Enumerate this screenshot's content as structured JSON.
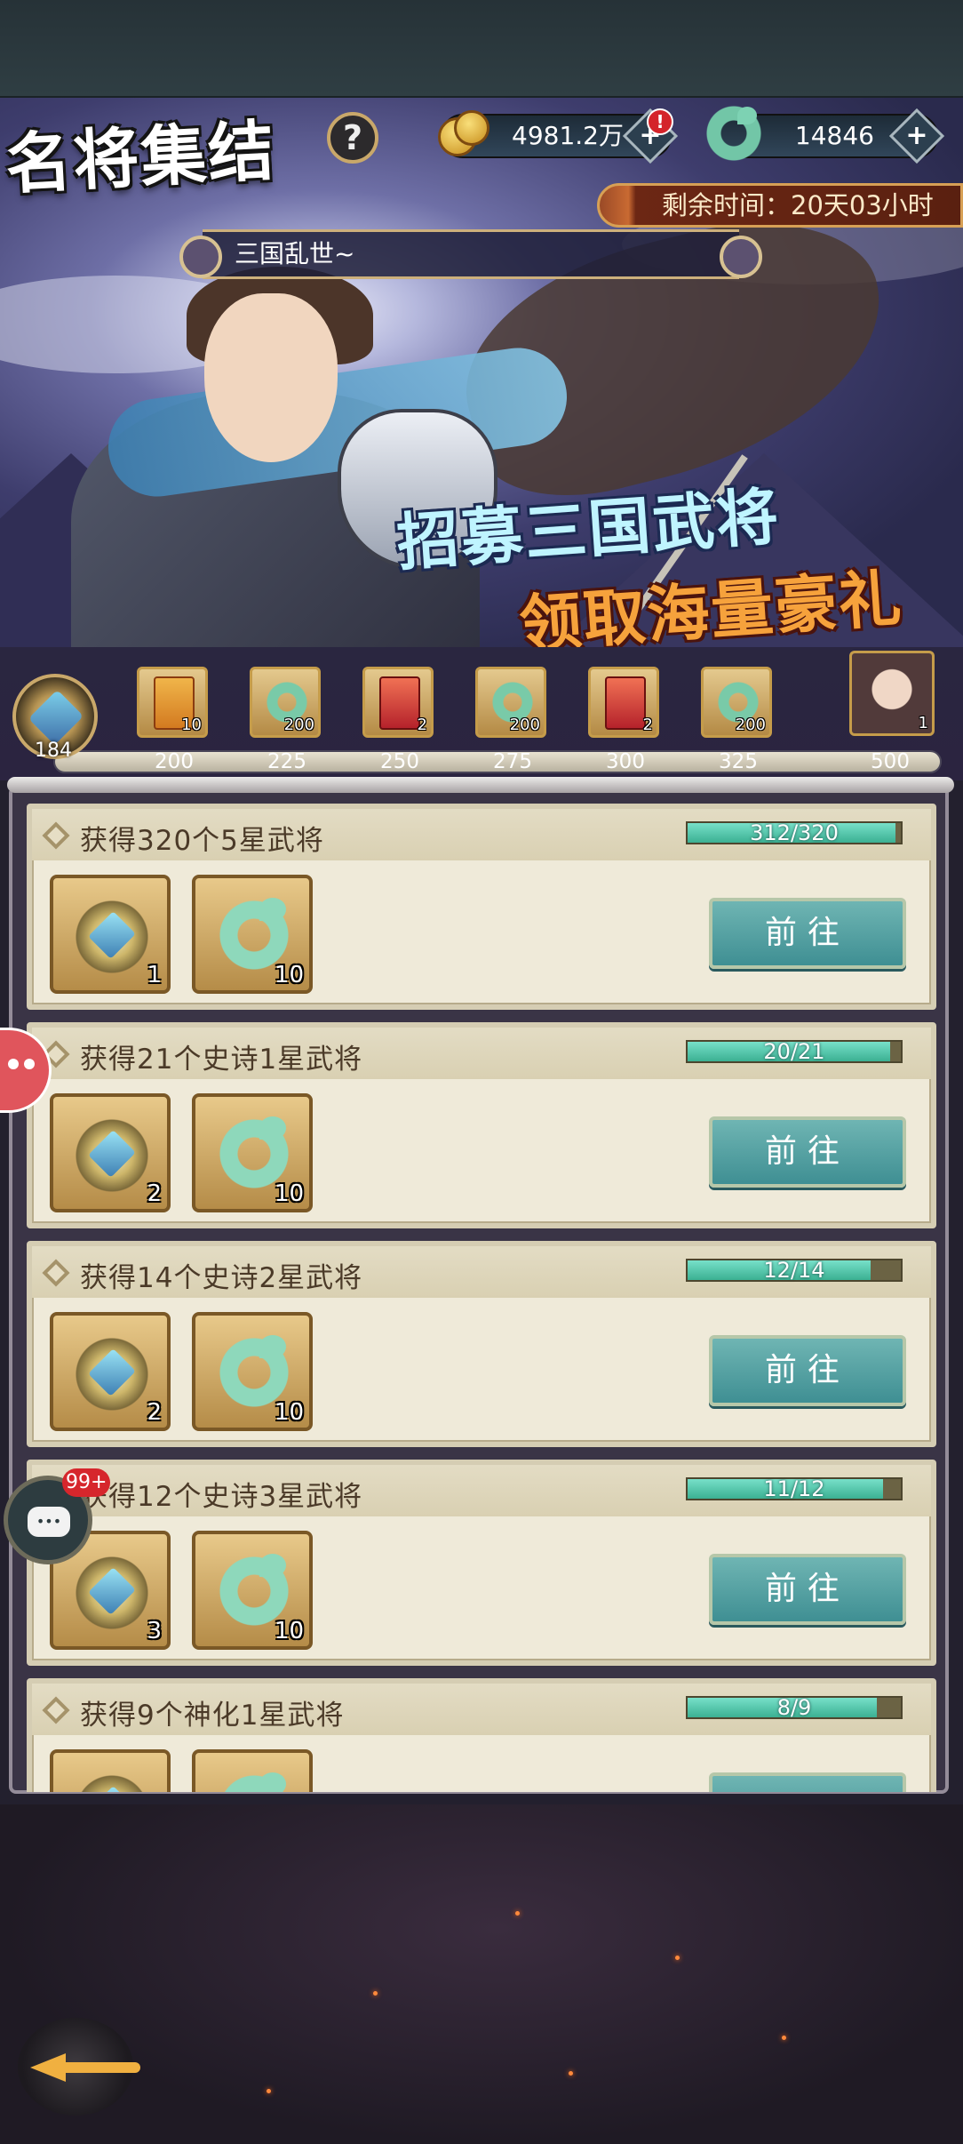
{
  "header": {
    "title": "名将集结",
    "help_icon": "question-icon",
    "coins": {
      "value": "4981.2万",
      "icon": "coin-pile-icon",
      "alert": "!"
    },
    "jade": {
      "value": "14846",
      "icon": "jade-ring-icon"
    },
    "plus_glyph": "+",
    "timer": "剩余时间：20天03小时",
    "subtitle": "三国乱世~"
  },
  "banner": {
    "slogan_line1": "招募三国武将",
    "slogan_line2": "领取海量豪礼"
  },
  "milestones": {
    "current_points": "184",
    "items": [
      {
        "points": "200",
        "icon": "gold-book-icon",
        "qty": "10"
      },
      {
        "points": "225",
        "icon": "jade-ring-icon",
        "qty": "200"
      },
      {
        "points": "250",
        "icon": "red-book-icon",
        "qty": "2"
      },
      {
        "points": "275",
        "icon": "jade-ring-icon",
        "qty": "200"
      },
      {
        "points": "300",
        "icon": "red-book-icon",
        "qty": "2"
      },
      {
        "points": "325",
        "icon": "jade-ring-icon",
        "qty": "200"
      },
      {
        "points": "500",
        "icon": "hero-portrait-icon",
        "qty": "1"
      }
    ]
  },
  "tasks": [
    {
      "title": "获得320个5星武将",
      "progress": "312/320",
      "ratio": 0.975,
      "rewards": [
        {
          "icon": "token-icon",
          "qty": "1"
        },
        {
          "icon": "jade-ring-icon",
          "qty": "10"
        }
      ],
      "button": "前往"
    },
    {
      "title": "获得21个史诗1星武将",
      "progress": "20/21",
      "ratio": 0.952,
      "rewards": [
        {
          "icon": "token-icon",
          "qty": "2"
        },
        {
          "icon": "jade-ring-icon",
          "qty": "10"
        }
      ],
      "button": "前往"
    },
    {
      "title": "获得14个史诗2星武将",
      "progress": "12/14",
      "ratio": 0.857,
      "rewards": [
        {
          "icon": "token-icon",
          "qty": "2"
        },
        {
          "icon": "jade-ring-icon",
          "qty": "10"
        }
      ],
      "button": "前往"
    },
    {
      "title": "获得12个史诗3星武将",
      "progress": "11/12",
      "ratio": 0.917,
      "rewards": [
        {
          "icon": "token-icon",
          "qty": "3"
        },
        {
          "icon": "jade-ring-icon",
          "qty": "10"
        }
      ],
      "button": "前往"
    },
    {
      "title": "获得9个神化1星武将",
      "progress": "8/9",
      "ratio": 0.889,
      "rewards": [
        {
          "icon": "token-icon",
          "qty": ""
        },
        {
          "icon": "jade-ring-icon",
          "qty": ""
        }
      ],
      "button": ""
    }
  ],
  "floating": {
    "chat_badge": "99+",
    "chat_icon": "chat-bubble-icon",
    "side_icon": "gamepad-icon"
  },
  "nav": {
    "back_icon": "back-arrow-icon"
  },
  "colors": {
    "accent_teal": "#3f8f93",
    "progress": "#3bb092",
    "panel": "#efead9",
    "timer": "#5a2010"
  }
}
